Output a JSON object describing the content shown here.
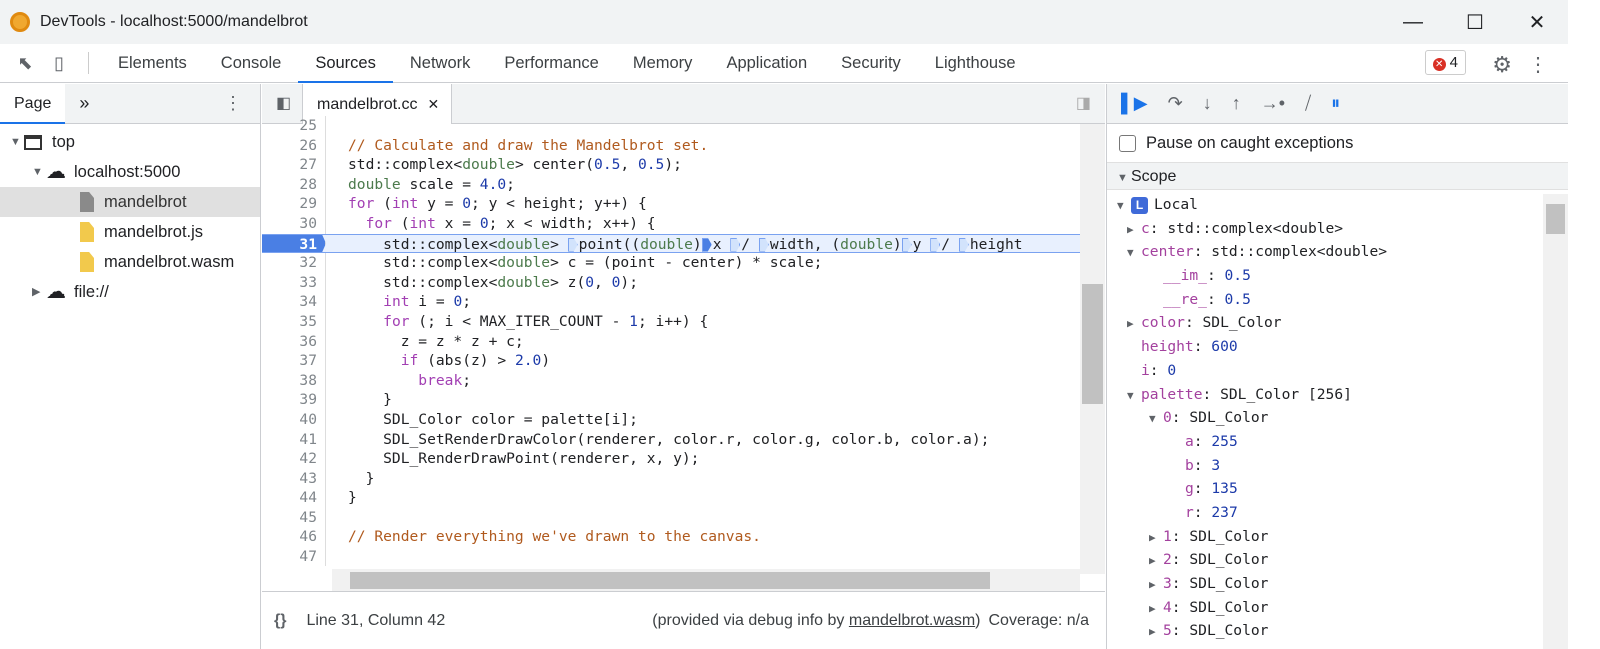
{
  "window": {
    "title": "DevTools - localhost:5000/mandelbrot",
    "minimize": "—",
    "maximize": "☐",
    "close": "✕"
  },
  "toolbar": {
    "tabs": [
      "Elements",
      "Console",
      "Sources",
      "Network",
      "Performance",
      "Memory",
      "Application",
      "Security",
      "Lighthouse"
    ],
    "active_tab": "Sources",
    "error_count": "4"
  },
  "navigator": {
    "tab": "Page",
    "more": "»",
    "tree": [
      {
        "label": "top",
        "depth": 0,
        "type": "frame",
        "arrow": "▼"
      },
      {
        "label": "localhost:5000",
        "depth": 1,
        "type": "cloud",
        "arrow": "▼"
      },
      {
        "label": "mandelbrot",
        "depth": 2,
        "type": "file-gray",
        "selected": true
      },
      {
        "label": "mandelbrot.js",
        "depth": 2,
        "type": "file"
      },
      {
        "label": "mandelbrot.wasm",
        "depth": 2,
        "type": "file"
      },
      {
        "label": "file://",
        "depth": 1,
        "type": "cloud",
        "arrow": "▶"
      }
    ]
  },
  "editor": {
    "file_tab": "mandelbrot.cc",
    "current_line": "31",
    "lines": [
      [
        "25",
        [
          [
            "",
            "  "
          ]
        ]
      ],
      [
        "26",
        [
          [
            "c",
            "// Calculate and draw the Mandelbrot set."
          ]
        ]
      ],
      [
        "27",
        [
          [
            "",
            "std::complex<"
          ],
          [
            "t",
            "double"
          ],
          [
            "",
            "> center("
          ],
          [
            "n",
            "0.5"
          ],
          [
            "",
            ", "
          ],
          [
            "n",
            "0.5"
          ],
          [
            "",
            ");"
          ]
        ]
      ],
      [
        "28",
        [
          [
            "t",
            "double"
          ],
          [
            "",
            " scale = "
          ],
          [
            "n",
            "4.0"
          ],
          [
            "",
            ";"
          ]
        ]
      ],
      [
        "29",
        [
          [
            "k",
            "for"
          ],
          [
            "",
            " ("
          ],
          [
            "k",
            "int"
          ],
          [
            "",
            " y = "
          ],
          [
            "n",
            "0"
          ],
          [
            "",
            "; y < height; y++) {"
          ]
        ]
      ],
      [
        "30",
        [
          [
            "",
            "  "
          ],
          [
            "k",
            "for"
          ],
          [
            "",
            " ("
          ],
          [
            "k",
            "int"
          ],
          [
            "",
            " x = "
          ],
          [
            "n",
            "0"
          ],
          [
            "",
            "; x < width; x++) {"
          ]
        ]
      ],
      [
        "31",
        [
          [
            "",
            "    std::complex<"
          ],
          [
            "t",
            "double"
          ],
          [
            "",
            "> "
          ],
          [
            "bp",
            ""
          ],
          [
            "",
            "point(("
          ],
          [
            "t",
            "double"
          ],
          [
            "",
            ")"
          ],
          [
            "bpf",
            ""
          ],
          [
            "",
            "x "
          ],
          [
            "bp",
            ""
          ],
          [
            "",
            "/ "
          ],
          [
            "bp",
            ""
          ],
          [
            "",
            "width, ("
          ],
          [
            "t",
            "double"
          ],
          [
            "",
            ")"
          ],
          [
            "bp",
            ""
          ],
          [
            "",
            "y "
          ],
          [
            "bp",
            ""
          ],
          [
            "",
            "/ "
          ],
          [
            "bp",
            ""
          ],
          [
            "",
            "height"
          ]
        ]
      ],
      [
        "32",
        [
          [
            "",
            "    std::complex<"
          ],
          [
            "t",
            "double"
          ],
          [
            "",
            "> c = (point - center) * scale;"
          ]
        ]
      ],
      [
        "33",
        [
          [
            "",
            "    std::complex<"
          ],
          [
            "t",
            "double"
          ],
          [
            "",
            "> z("
          ],
          [
            "n",
            "0"
          ],
          [
            "",
            ", "
          ],
          [
            "n",
            "0"
          ],
          [
            "",
            ");"
          ]
        ]
      ],
      [
        "34",
        [
          [
            "",
            "    "
          ],
          [
            "k",
            "int"
          ],
          [
            "",
            " i = "
          ],
          [
            "n",
            "0"
          ],
          [
            "",
            ";"
          ]
        ]
      ],
      [
        "35",
        [
          [
            "",
            "    "
          ],
          [
            "k",
            "for"
          ],
          [
            "",
            " (; i < MAX_ITER_COUNT - "
          ],
          [
            "n",
            "1"
          ],
          [
            "",
            "; i++) {"
          ]
        ]
      ],
      [
        "36",
        [
          [
            "",
            "      z = z * z + c;"
          ]
        ]
      ],
      [
        "37",
        [
          [
            "",
            "      "
          ],
          [
            "k",
            "if"
          ],
          [
            "",
            " (abs(z) > "
          ],
          [
            "n",
            "2.0"
          ],
          [
            "",
            ")"
          ]
        ]
      ],
      [
        "38",
        [
          [
            "",
            "        "
          ],
          [
            "k",
            "break"
          ],
          [
            "",
            ";"
          ]
        ]
      ],
      [
        "39",
        [
          [
            "",
            "    }"
          ]
        ]
      ],
      [
        "40",
        [
          [
            "",
            "    SDL_Color color = palette[i];"
          ]
        ]
      ],
      [
        "41",
        [
          [
            "",
            "    SDL_SetRenderDrawColor(renderer, color.r, color.g, color.b, color.a);"
          ]
        ]
      ],
      [
        "42",
        [
          [
            "",
            "    SDL_RenderDrawPoint(renderer, x, y);"
          ]
        ]
      ],
      [
        "43",
        [
          [
            "",
            "  }"
          ]
        ]
      ],
      [
        "44",
        [
          [
            "",
            "}"
          ]
        ]
      ],
      [
        "45",
        [
          [
            "",
            ""
          ]
        ]
      ],
      [
        "46",
        [
          [
            "c",
            "// Render everything we've drawn to the canvas."
          ]
        ]
      ],
      [
        "47",
        [
          [
            "",
            ""
          ]
        ]
      ]
    ],
    "status": {
      "position": "Line 31, Column 42",
      "provided_prefix": "(provided via debug info by ",
      "provided_link": "mandelbrot.wasm",
      "provided_suffix": ")",
      "coverage": "Coverage: n/a"
    }
  },
  "debugger": {
    "pause_caught_label": "Pause on caught exceptions",
    "pause_caught_checked": false,
    "scope_label": "Scope",
    "local_label": "Local",
    "local_badge": "L",
    "vars": [
      {
        "indent": 1,
        "arrow": "▶",
        "key": "c",
        "value": "std::complex<double>"
      },
      {
        "indent": 1,
        "arrow": "▼",
        "key": "center",
        "value": "std::complex<double>"
      },
      {
        "indent": 2,
        "key": "__im_",
        "value": "0.5",
        "num": true
      },
      {
        "indent": 2,
        "key": "__re_",
        "value": "0.5",
        "num": true
      },
      {
        "indent": 1,
        "arrow": "▶",
        "key": "color",
        "value": "SDL_Color"
      },
      {
        "indent": 1,
        "key": "height",
        "value": "600",
        "num": true
      },
      {
        "indent": 1,
        "key": "i",
        "value": "0",
        "num": true
      },
      {
        "indent": 1,
        "arrow": "▼",
        "key": "palette",
        "value": "SDL_Color [256]"
      },
      {
        "indent": 2,
        "arrow": "▼",
        "key": "0",
        "value": "SDL_Color"
      },
      {
        "indent": 3,
        "key": "a",
        "value": "255",
        "num": true
      },
      {
        "indent": 3,
        "key": "b",
        "value": "3",
        "num": true
      },
      {
        "indent": 3,
        "key": "g",
        "value": "135",
        "num": true
      },
      {
        "indent": 3,
        "key": "r",
        "value": "237",
        "num": true
      },
      {
        "indent": 2,
        "arrow": "▶",
        "key": "1",
        "value": "SDL_Color"
      },
      {
        "indent": 2,
        "arrow": "▶",
        "key": "2",
        "value": "SDL_Color"
      },
      {
        "indent": 2,
        "arrow": "▶",
        "key": "3",
        "value": "SDL_Color"
      },
      {
        "indent": 2,
        "arrow": "▶",
        "key": "4",
        "value": "SDL_Color"
      },
      {
        "indent": 2,
        "arrow": "▶",
        "key": "5",
        "value": "SDL_Color"
      }
    ]
  },
  "colors": {
    "accent": "#1a73e8",
    "current_line": "#4a7fe4"
  }
}
